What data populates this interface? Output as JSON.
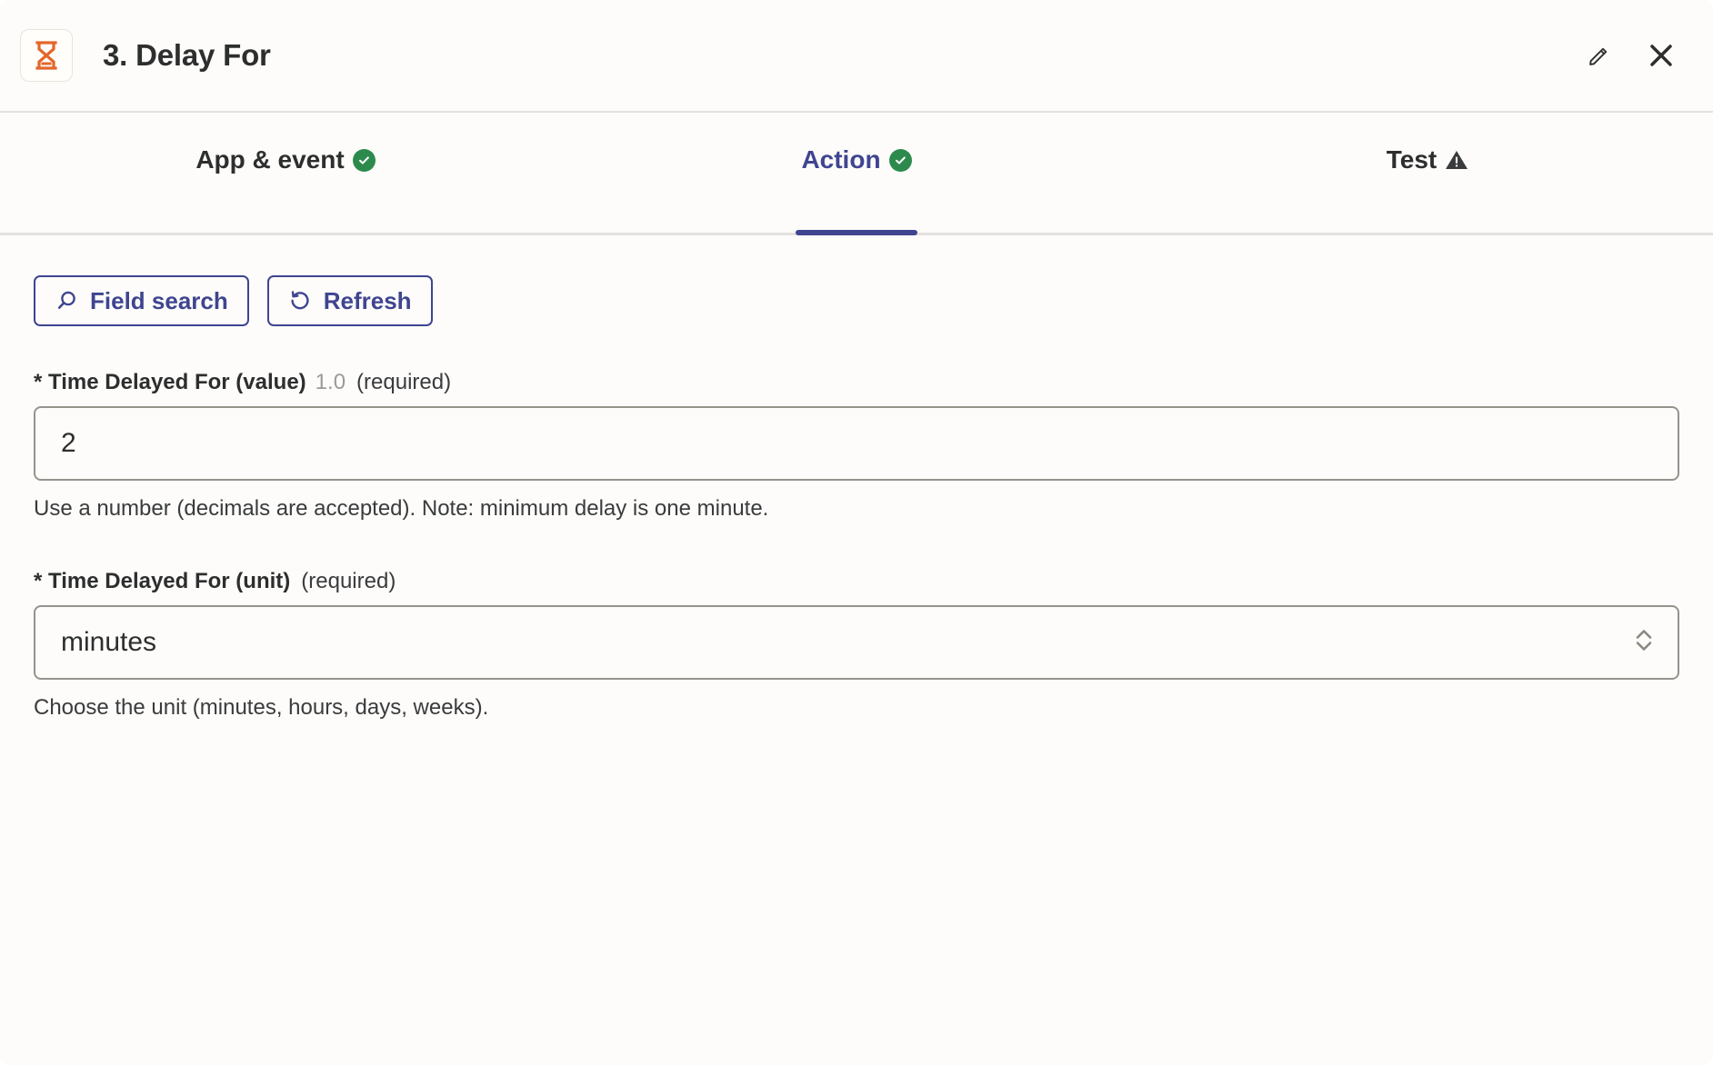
{
  "header": {
    "title": "3. Delay For",
    "app_icon": "hourglass-icon",
    "edit_icon": "pencil-icon",
    "close_icon": "close-icon",
    "icon_color": "#E3662B"
  },
  "tabs": [
    {
      "label": "App & event",
      "status_icon": "check-circle-icon",
      "active": false
    },
    {
      "label": "Action",
      "status_icon": "check-circle-icon",
      "active": true
    },
    {
      "label": "Test",
      "status_icon": "warning-triangle-icon",
      "active": false
    }
  ],
  "toolbar": {
    "field_search_label": "Field search",
    "field_search_icon": "search-icon",
    "refresh_label": "Refresh",
    "refresh_icon": "refresh-icon"
  },
  "fields": [
    {
      "label": "* Time Delayed For (value)",
      "default_hint": "1.0",
      "required_text": "(required)",
      "value": "2",
      "help": "Use a number (decimals are accepted). Note: minimum delay is one minute."
    },
    {
      "label": "* Time Delayed For (unit)",
      "default_hint": "",
      "required_text": "(required)",
      "value": "minutes",
      "help": "Choose the unit (minutes, hours, days, weeks).",
      "options": [
        "minutes",
        "hours",
        "days",
        "weeks"
      ],
      "stepper_icon": "chevron-updown-icon"
    }
  ],
  "colors": {
    "accent": "#3F4590",
    "success": "#2C8A4D",
    "brand_orange": "#E3662B",
    "background": "#FDFCFA",
    "border": "#96938D"
  }
}
